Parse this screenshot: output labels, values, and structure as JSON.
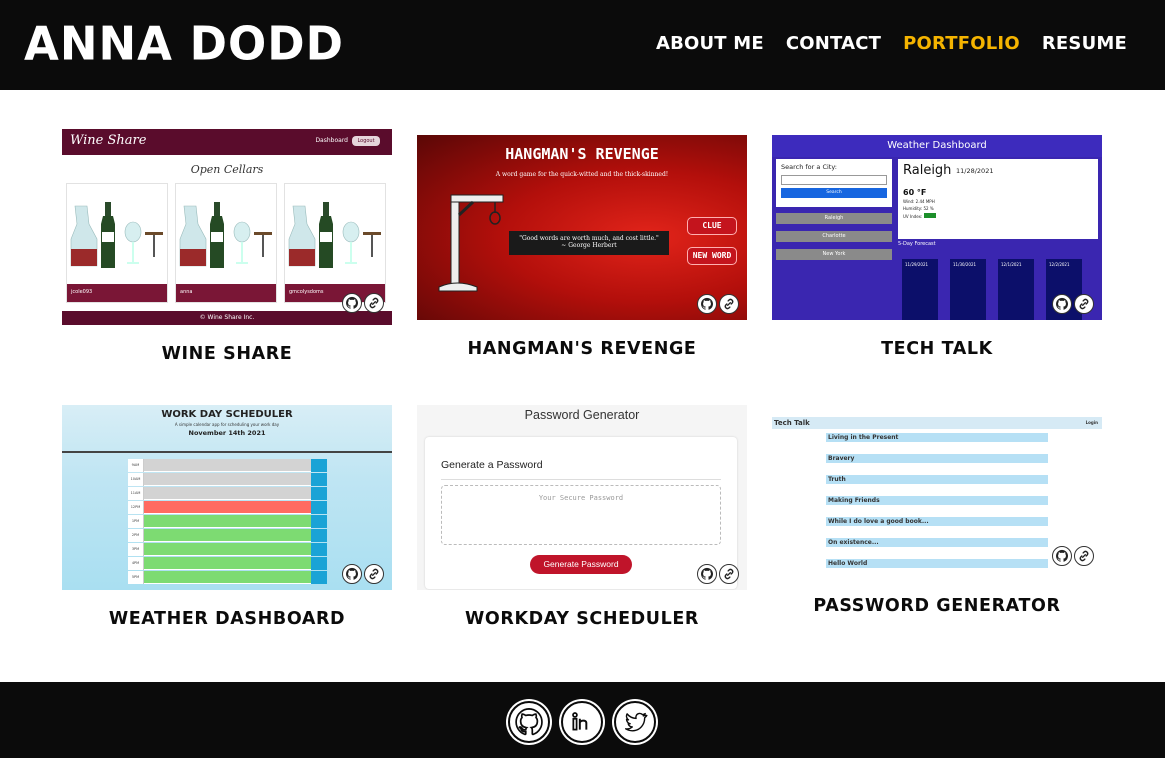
{
  "header": {
    "brand": "ANNA DODD",
    "nav": [
      {
        "label": "ABOUT ME"
      },
      {
        "label": "CONTACT"
      },
      {
        "label": "PORTFOLIO"
      },
      {
        "label": "RESUME"
      }
    ],
    "active_color": "#f5b400"
  },
  "projects": [
    {
      "title": "WINE SHARE"
    },
    {
      "title": "HANGMAN'S REVENGE"
    },
    {
      "title": "TECH TALK"
    },
    {
      "title": "WEATHER DASHBOARD"
    },
    {
      "title": "WORKDAY SCHEDULER"
    },
    {
      "title": "PASSWORD GENERATOR"
    }
  ],
  "thumbs": {
    "wine": {
      "logo": "Wine Share",
      "dashboard": "Dashboard",
      "logout": "Logout",
      "subtitle": "Open Cellars",
      "users": [
        "jcole093",
        "anna",
        "gmcolysdoms"
      ],
      "footer": "© Wine Share Inc."
    },
    "hangman": {
      "title": "HANGMAN'S REVENGE",
      "subtitle": "A word game for the quick-witted and the thick-skinned!",
      "quote": "\"Good words are worth much, and cost little.\"",
      "author": "~ George Herbert",
      "clue": "CLUE",
      "new_word": "NEW WORD"
    },
    "weather": {
      "header": "Weather Dashboard",
      "search_label": "Search for a City:",
      "search_btn": "Search",
      "cities": [
        "Raleigh",
        "Charlotte",
        "New York"
      ],
      "city": "Raleigh",
      "date": "11/28/2021",
      "temp": "60 °F",
      "wind": "Wind: 2.44 MPH",
      "humidity": "Humidity: 52 %",
      "uv": "UV Index:",
      "forecast_label": "5-Day Forecast",
      "days": [
        "11/29/2021",
        "11/30/2021",
        "12/1/2021",
        "12/2/2021"
      ]
    },
    "scheduler": {
      "title": "WORK DAY SCHEDULER",
      "subtitle": "A simple calendar app for scheduling your work day",
      "date": "November 14th 2021",
      "hours": [
        "9AM",
        "10AM",
        "11AM",
        "12PM",
        "1PM",
        "2PM",
        "3PM",
        "4PM",
        "5PM"
      ]
    },
    "password": {
      "title": "Password Generator",
      "subtitle": "Generate a Password",
      "placeholder": "Your Secure Password",
      "button": "Generate Password"
    },
    "techtalk": {
      "title": "Tech Talk",
      "login": "Login",
      "posts": [
        "Living in the Present",
        "Bravery",
        "Truth",
        "Making Friends",
        "While I do love a good book...",
        "On existence...",
        "Hello World"
      ]
    }
  },
  "footer": {
    "icons": [
      "github-icon",
      "linkedin-icon",
      "twitter-icon"
    ]
  }
}
